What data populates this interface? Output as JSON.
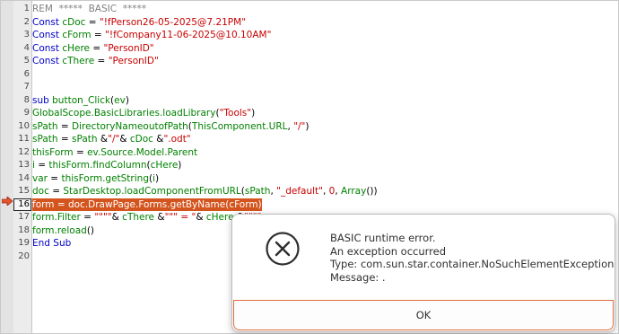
{
  "editor": {
    "lines": [
      {
        "num": "1",
        "tokens": [
          {
            "t": "REM  *****  BASIC  *****",
            "c": "comment"
          }
        ]
      },
      {
        "num": "2",
        "tokens": [
          {
            "t": "Const ",
            "c": "kw"
          },
          {
            "t": "cDoc",
            "c": "ident"
          },
          {
            "t": " = ",
            "c": "plain"
          },
          {
            "t": "\"!fPerson26-05-2025@7.21PM\"",
            "c": "str"
          }
        ]
      },
      {
        "num": "3",
        "tokens": [
          {
            "t": "Const ",
            "c": "kw"
          },
          {
            "t": "cForm",
            "c": "ident"
          },
          {
            "t": " = ",
            "c": "plain"
          },
          {
            "t": "\"!fCompany11-06-2025@10.10AM\"",
            "c": "str"
          }
        ]
      },
      {
        "num": "4",
        "tokens": [
          {
            "t": "Const ",
            "c": "kw"
          },
          {
            "t": "cHere",
            "c": "ident"
          },
          {
            "t": " = ",
            "c": "plain"
          },
          {
            "t": "\"PersonID\"",
            "c": "str"
          }
        ]
      },
      {
        "num": "5",
        "tokens": [
          {
            "t": "Const ",
            "c": "kw"
          },
          {
            "t": "cThere",
            "c": "ident"
          },
          {
            "t": " = ",
            "c": "plain"
          },
          {
            "t": "\"PersonID\"",
            "c": "str"
          }
        ]
      },
      {
        "num": "6",
        "tokens": []
      },
      {
        "num": "7",
        "tokens": []
      },
      {
        "num": "8",
        "tokens": [
          {
            "t": "sub ",
            "c": "kw"
          },
          {
            "t": "button_Click",
            "c": "ident"
          },
          {
            "t": "(",
            "c": "plain"
          },
          {
            "t": "ev",
            "c": "ident"
          },
          {
            "t": ")",
            "c": "plain"
          }
        ]
      },
      {
        "num": "9",
        "tokens": [
          {
            "t": "GlobalScope.BasicLibraries.loadLibrary",
            "c": "ident"
          },
          {
            "t": "(",
            "c": "plain"
          },
          {
            "t": "\"Tools\"",
            "c": "str"
          },
          {
            "t": ")",
            "c": "plain"
          }
        ]
      },
      {
        "num": "10",
        "tokens": [
          {
            "t": "sPath",
            "c": "ident"
          },
          {
            "t": " = ",
            "c": "plain"
          },
          {
            "t": "DirectoryNameoutofPath",
            "c": "ident"
          },
          {
            "t": "(",
            "c": "plain"
          },
          {
            "t": "ThisComponent.URL",
            "c": "ident"
          },
          {
            "t": ", ",
            "c": "plain"
          },
          {
            "t": "\"/\"",
            "c": "str"
          },
          {
            "t": ")",
            "c": "plain"
          }
        ]
      },
      {
        "num": "11",
        "tokens": [
          {
            "t": "sPath",
            "c": "ident"
          },
          {
            "t": " = ",
            "c": "plain"
          },
          {
            "t": "sPath",
            "c": "ident"
          },
          {
            "t": " &",
            "c": "plain"
          },
          {
            "t": "\"/\"",
            "c": "str"
          },
          {
            "t": "& ",
            "c": "plain"
          },
          {
            "t": "cDoc",
            "c": "ident"
          },
          {
            "t": " &",
            "c": "plain"
          },
          {
            "t": "\".odt\"",
            "c": "str"
          }
        ]
      },
      {
        "num": "12",
        "tokens": [
          {
            "t": "thisForm",
            "c": "ident"
          },
          {
            "t": " = ",
            "c": "plain"
          },
          {
            "t": "ev.Source.Model.Parent",
            "c": "ident"
          }
        ]
      },
      {
        "num": "13",
        "tokens": [
          {
            "t": "i",
            "c": "ident"
          },
          {
            "t": " = ",
            "c": "plain"
          },
          {
            "t": "thisForm.findColumn",
            "c": "ident"
          },
          {
            "t": "(",
            "c": "plain"
          },
          {
            "t": "cHere",
            "c": "ident"
          },
          {
            "t": ")",
            "c": "plain"
          }
        ]
      },
      {
        "num": "14",
        "tokens": [
          {
            "t": "var",
            "c": "ident"
          },
          {
            "t": " = ",
            "c": "plain"
          },
          {
            "t": "thisForm.getString",
            "c": "ident"
          },
          {
            "t": "(",
            "c": "plain"
          },
          {
            "t": "i",
            "c": "ident"
          },
          {
            "t": ")",
            "c": "plain"
          }
        ]
      },
      {
        "num": "15",
        "tokens": [
          {
            "t": "doc",
            "c": "ident"
          },
          {
            "t": " = ",
            "c": "plain"
          },
          {
            "t": "StarDesktop.loadComponentFromURL",
            "c": "ident"
          },
          {
            "t": "(",
            "c": "plain"
          },
          {
            "t": "sPath",
            "c": "ident"
          },
          {
            "t": ", ",
            "c": "plain"
          },
          {
            "t": "\"_default\"",
            "c": "str"
          },
          {
            "t": ", ",
            "c": "plain"
          },
          {
            "t": "0",
            "c": "num"
          },
          {
            "t": ", ",
            "c": "plain"
          },
          {
            "t": "Array",
            "c": "ident"
          },
          {
            "t": "())",
            "c": "plain"
          }
        ]
      },
      {
        "num": "16",
        "tokens": [
          {
            "t": "form = doc.DrawPage.Forms.getByName(cForm)",
            "c": "hl-text"
          }
        ]
      },
      {
        "num": "17",
        "tokens": [
          {
            "t": "form.Filter",
            "c": "ident"
          },
          {
            "t": " = ",
            "c": "plain"
          },
          {
            "t": "\"\"\"\"",
            "c": "str"
          },
          {
            "t": "& ",
            "c": "plain"
          },
          {
            "t": "cThere",
            "c": "ident"
          },
          {
            "t": " &",
            "c": "plain"
          },
          {
            "t": "\"\"\" = \"",
            "c": "str"
          },
          {
            "t": "& ",
            "c": "plain"
          },
          {
            "t": "cHere",
            "c": "ident"
          },
          {
            "t": " &",
            "c": "plain"
          },
          {
            "t": "\"\"\"\"",
            "c": "str"
          }
        ]
      },
      {
        "num": "18",
        "tokens": [
          {
            "t": "form.reload",
            "c": "ident"
          },
          {
            "t": "()",
            "c": "plain"
          }
        ]
      },
      {
        "num": "19",
        "tokens": [
          {
            "t": "End Sub",
            "c": "kw"
          }
        ]
      },
      {
        "num": "20",
        "tokens": []
      }
    ],
    "current_line": "16",
    "colors": {
      "highlight": "#d4541e",
      "keyword": "#0000c8",
      "string": "#c80000",
      "identifier": "#008000"
    }
  },
  "dialog": {
    "icon": "error-circle-x-icon",
    "message": {
      "title": "BASIC runtime error.",
      "line1": "An exception occurred",
      "line2": "Type: com.sun.star.container.NoSuchElementException",
      "line3": "Message: ."
    },
    "ok_label": "OK",
    "accent": "#e06c3c"
  }
}
